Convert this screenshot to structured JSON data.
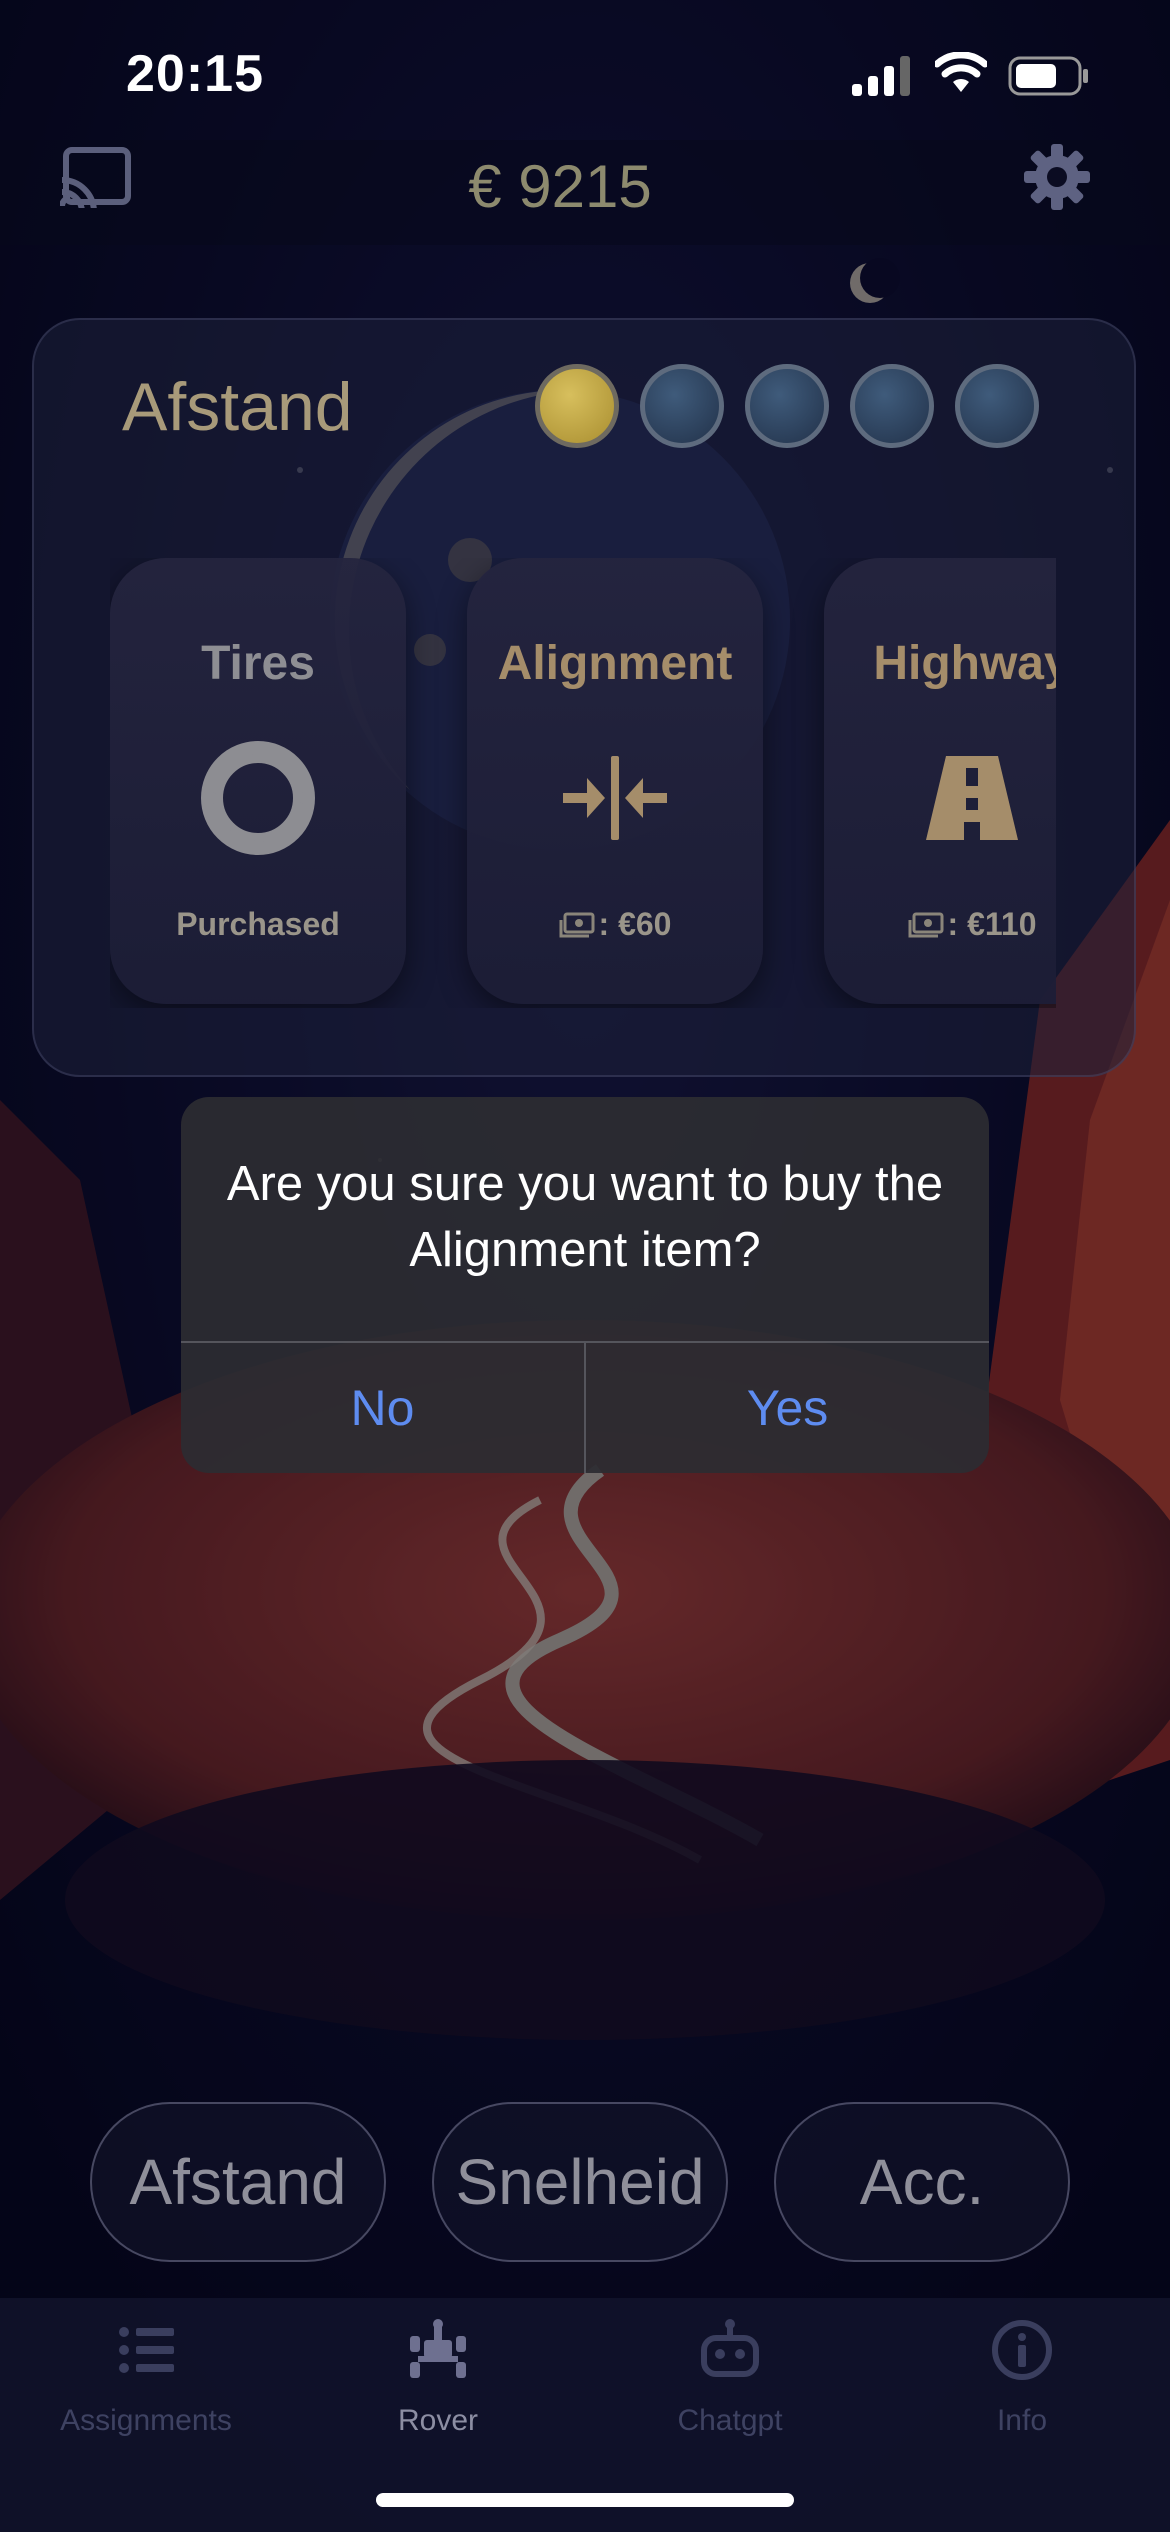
{
  "status_bar": {
    "time": "20:15"
  },
  "header": {
    "balance": "€ 9215",
    "cast_icon": "cast-icon",
    "settings_icon": "gear-icon"
  },
  "category_panel": {
    "title": "Afstand",
    "level_dots": [
      true,
      false,
      false,
      false,
      false
    ],
    "cards": [
      {
        "title": "Tires",
        "icon": "tire-icon",
        "subtitle": "Purchased",
        "price_icon": false
      },
      {
        "title": "Alignment",
        "icon": "alignment-icon",
        "subtitle": ": €60",
        "price_icon": "money-icon"
      },
      {
        "title": "Highway",
        "icon": "highway-icon",
        "subtitle": ": €110",
        "price_icon": "money-icon"
      }
    ]
  },
  "dialog": {
    "message": "Are you sure you want to buy the Alignment item?",
    "no_label": "No",
    "yes_label": "Yes"
  },
  "segments": [
    "Afstand",
    "Snelheid",
    "Acc."
  ],
  "tabs": [
    {
      "label": "Assignments",
      "icon": "list-icon",
      "active": false
    },
    {
      "label": "Rover",
      "icon": "rover-icon",
      "active": true
    },
    {
      "label": "Chatgpt",
      "icon": "robot-icon",
      "active": false
    },
    {
      "label": "Info",
      "icon": "info-icon",
      "active": false
    }
  ],
  "colors": {
    "accent_gold": "#c9b04e",
    "dialog_button_blue": "#5e8cf0",
    "card_title_tires": "#8e8e93",
    "card_title_gold": "#a58d6a"
  }
}
